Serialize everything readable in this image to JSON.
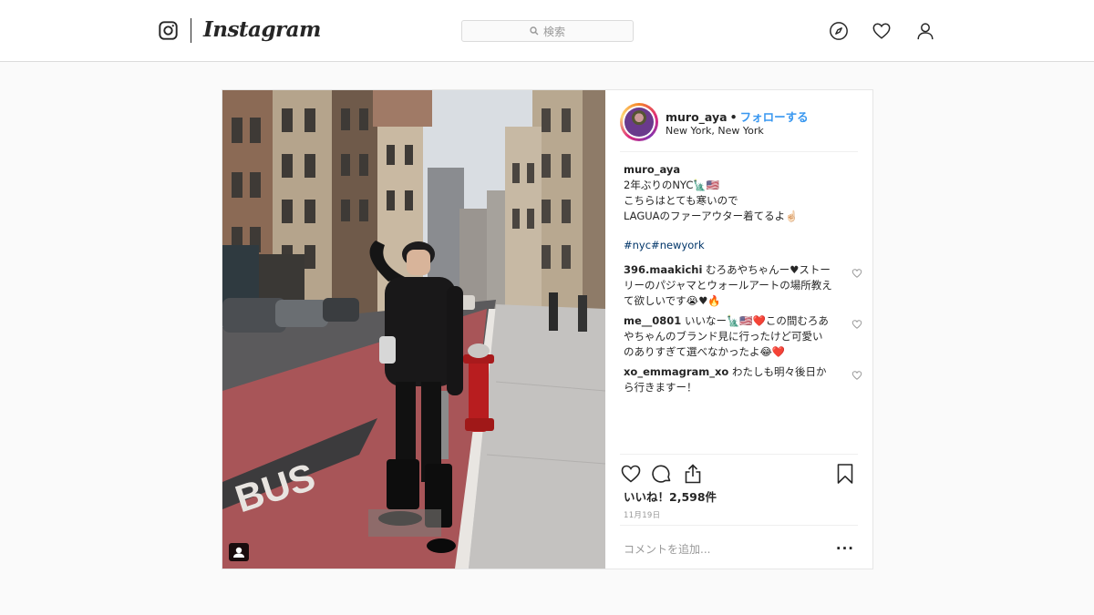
{
  "header": {
    "brand": "Instagram",
    "search_placeholder": "検索",
    "icons": [
      "instagram-camera-icon",
      "search-icon",
      "compass-icon",
      "heart-icon",
      "profile-icon"
    ]
  },
  "post": {
    "username": "muro_aya",
    "separator": "•",
    "follow_label": "フォローする",
    "location": "New York, New York",
    "caption": {
      "username": "muro_aya",
      "lines": [
        "2年ぶりのNYC🗽🇺🇸",
        "こちらはとても寒いので",
        "LAGUAのファーアウター着てるよ☝🏻"
      ],
      "hashtags": "#nyc#newyork"
    },
    "comments": [
      {
        "username": "396.maakichi",
        "text": "むろあやちゃんー♥ストーリーのパジャマとウォールアートの場所教えて欲しいです😭♥🔥"
      },
      {
        "username": "me__0801",
        "text": "いいなー🗽🇺🇸❤️この間むろあやちゃんのブランド見に行ったけど可愛いのありすぎて選べなかったよ😂❤️"
      },
      {
        "username": "xo_emmagram_xo",
        "text": "わたしも明々後日から行きますー！"
      }
    ],
    "likes": "いいね！2,598件",
    "date": "11月19日",
    "comment_placeholder": "コメントを追加...",
    "more_label": "..."
  },
  "colors": {
    "link_blue": "#3897f0",
    "hashtag": "#003569",
    "border": "#dbdbdb",
    "background": "#fafafa"
  }
}
